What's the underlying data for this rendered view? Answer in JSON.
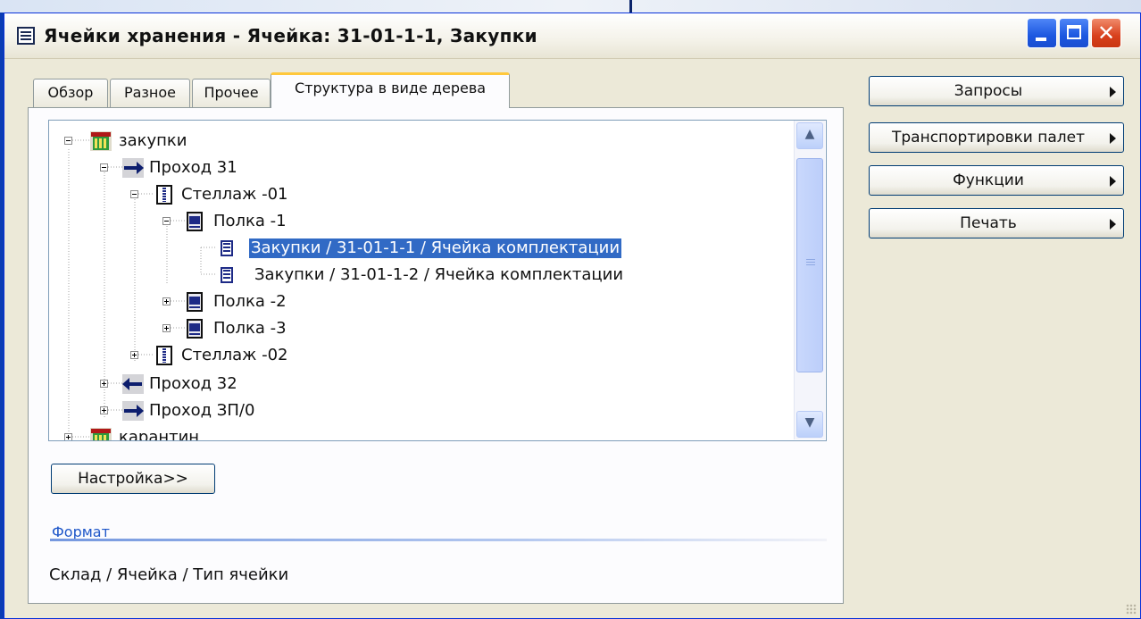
{
  "window": {
    "title": "Ячейки хранения - Ячейка: 31-01-1-1, Закупки",
    "controls": [
      "minimize",
      "maximize",
      "close"
    ]
  },
  "tabs": [
    {
      "label": "Обзор",
      "active": false
    },
    {
      "label": "Разное",
      "active": false
    },
    {
      "label": "Прочее",
      "active": false
    },
    {
      "label": "Структура в виде дерева",
      "active": true
    }
  ],
  "tree": {
    "nodes": [
      {
        "label": "закупки",
        "icon": "warehouse-icon",
        "expanded": true
      },
      {
        "label": "Проход 31",
        "icon": "arrow-right-icon",
        "expanded": true
      },
      {
        "label": "Стеллаж -01",
        "icon": "rack-icon",
        "expanded": true
      },
      {
        "label": "Полка -1",
        "icon": "shelf-icon",
        "expanded": true
      },
      {
        "label": "Закупки / 31-01-1-1 / Ячейка комплектации",
        "icon": "cell-icon",
        "selected": true
      },
      {
        "label": "Закупки / 31-01-1-2 / Ячейка комплектации",
        "icon": "cell-icon"
      },
      {
        "label": "Полка -2",
        "icon": "shelf-icon",
        "expanded": false
      },
      {
        "label": "Полка -3",
        "icon": "shelf-icon",
        "expanded": false
      },
      {
        "label": "Стеллаж -02",
        "icon": "rack-icon",
        "expanded": false
      },
      {
        "label": "Проход 32",
        "icon": "arrow-left-icon",
        "expanded": false
      },
      {
        "label": "Проход ЗП/0",
        "icon": "arrow-right-icon",
        "expanded": false
      },
      {
        "label": "карантин",
        "icon": "warehouse-icon",
        "expanded": false
      }
    ],
    "scroll_icons": {
      "up": "scroll-up-icon",
      "down": "scroll-down-icon"
    }
  },
  "settings_button": {
    "label": "Настройка>>"
  },
  "format": {
    "title": "Формат",
    "value": "Склад / Ячейка / Тип ячейки"
  },
  "side_buttons": [
    {
      "label": "Запросы"
    },
    {
      "label": "Транспортировки палет"
    },
    {
      "label": "Функции"
    },
    {
      "label": "Печать"
    }
  ],
  "colors": {
    "selection": "#316ac5",
    "titlebar_buttons": "#1c57e0",
    "close_button": "#d8401c",
    "active_tab_accent": "#ffc83c"
  }
}
